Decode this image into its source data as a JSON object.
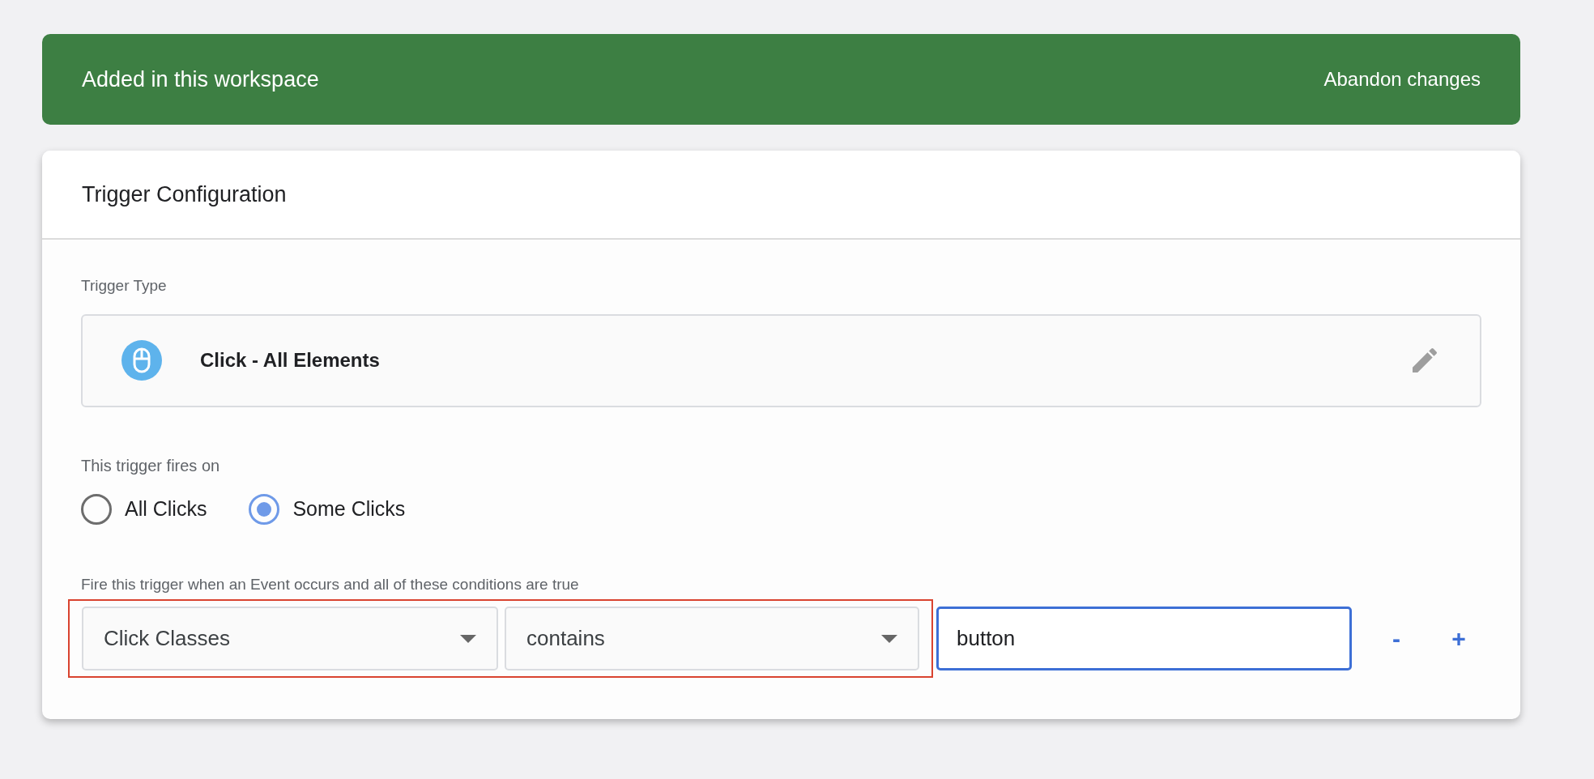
{
  "banner": {
    "title": "Added in this workspace",
    "action": "Abandon changes"
  },
  "card": {
    "title": "Trigger Configuration",
    "trigger_type": {
      "label": "Trigger Type",
      "value": "Click - All Elements"
    },
    "fires_on": {
      "label": "This trigger fires on",
      "options": [
        {
          "label": "All Clicks",
          "selected": false
        },
        {
          "label": "Some Clicks",
          "selected": true
        }
      ]
    },
    "conditions": {
      "label": "Fire this trigger when an Event occurs and all of these conditions are true",
      "variable": "Click Classes",
      "operator": "contains",
      "value": "button",
      "remove": "-",
      "add": "+"
    }
  }
}
